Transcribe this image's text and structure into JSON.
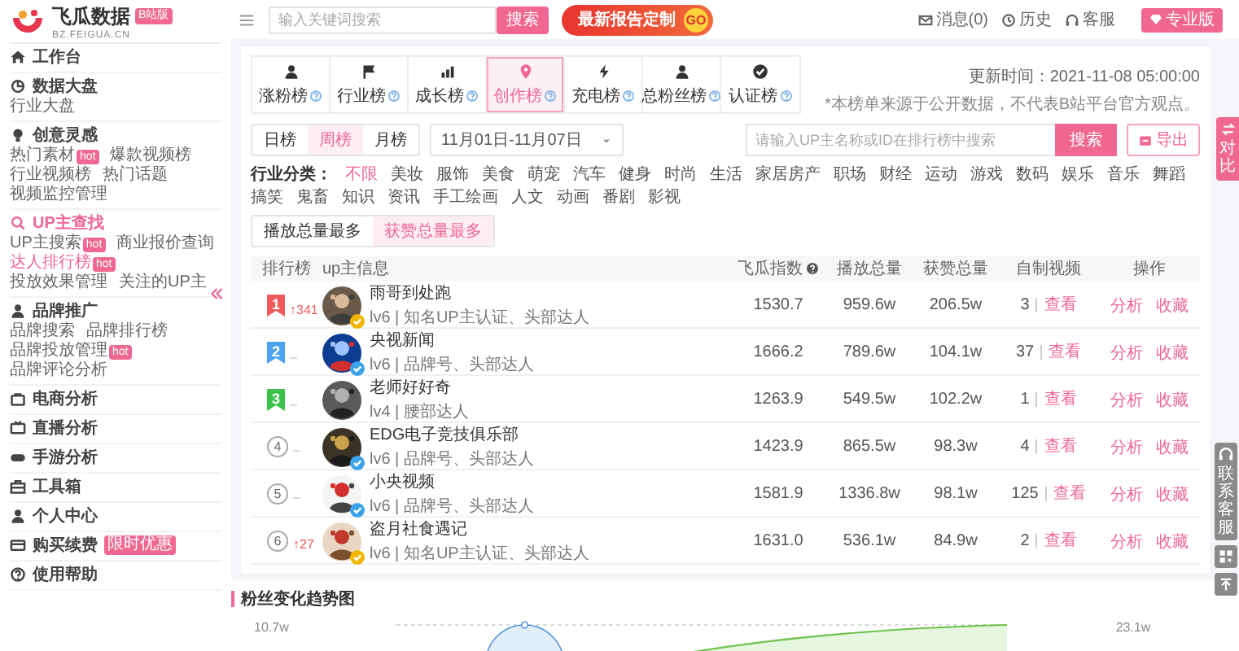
{
  "sidebar": {
    "logo": {
      "name": "飞瓜数据",
      "badge": "B站版",
      "domain": "BZ.FEIGUA.CN"
    },
    "sections": [
      {
        "kind": "home",
        "title": "工作台",
        "selected": false
      },
      {
        "kind": "chart",
        "title": "数据大盘",
        "selected": false,
        "items": [
          {
            "label": "行业大盘",
            "selected": false
          }
        ]
      },
      {
        "kind": "bulb",
        "title": "创意灵感",
        "selected": false,
        "items": [
          {
            "label": "热门素材",
            "badge": "hot",
            "selected": false
          },
          {
            "label": "爆款视频榜",
            "selected": false
          },
          {
            "label": "行业视频榜",
            "selected": false
          },
          {
            "label": "热门话题",
            "selected": false
          },
          {
            "label": "视频监控管理",
            "selected": false
          }
        ]
      },
      {
        "kind": "search",
        "title": "UP主查找",
        "selected": true,
        "items": [
          {
            "label": "UP主搜索",
            "badge": "hot",
            "selected": false
          },
          {
            "label": "商业报价查询",
            "selected": false
          },
          {
            "label": "达人排行榜",
            "badge": "hot",
            "selected": true
          },
          {
            "label": "投放效果管理",
            "selected": false
          },
          {
            "label": "关注的UP主",
            "selected": false
          }
        ]
      },
      {
        "kind": "user",
        "title": "品牌推广",
        "selected": false,
        "items": [
          {
            "label": "品牌搜索",
            "selected": false
          },
          {
            "label": "品牌排行榜",
            "selected": false
          },
          {
            "label": "品牌投放管理",
            "badge": "hot",
            "selected": false
          },
          {
            "label": "品牌评论分析",
            "selected": false
          }
        ]
      },
      {
        "kind": "cart",
        "title": "电商分析",
        "selected": false
      },
      {
        "kind": "live",
        "title": "直播分析",
        "selected": false
      },
      {
        "kind": "game",
        "title": "手游分析",
        "selected": false
      },
      {
        "kind": "tool",
        "title": "工具箱",
        "selected": false
      },
      {
        "kind": "user",
        "title": "个人中心",
        "selected": false
      },
      {
        "kind": "card",
        "title": "购买续费",
        "selected": false,
        "badge": "限时优惠"
      },
      {
        "kind": "help",
        "title": "使用帮助",
        "selected": false
      }
    ]
  },
  "topbar": {
    "search": {
      "placeholder": "输入关键词搜索"
    },
    "search_button": "搜索",
    "banner": {
      "title": "最新报告定制",
      "go": "GO"
    },
    "links": [
      {
        "kind": "mail",
        "label": "消息(0)"
      },
      {
        "kind": "clock",
        "label": "历史"
      },
      {
        "kind": "headset",
        "label": "客服"
      }
    ],
    "pro_button": "专业版"
  },
  "rank_tabs": [
    {
      "kind": "user",
      "label": "涨粉榜",
      "selected": false
    },
    {
      "kind": "flag",
      "label": "行业榜",
      "selected": false
    },
    {
      "kind": "growth",
      "label": "成长榜",
      "selected": false
    },
    {
      "kind": "pin",
      "label": "创作榜",
      "selected": true
    },
    {
      "kind": "bolt",
      "label": "充电榜",
      "selected": false
    },
    {
      "kind": "user",
      "label": "总粉丝榜",
      "selected": false
    },
    {
      "kind": "check",
      "label": "认证榜",
      "selected": false
    }
  ],
  "update": {
    "time": "更新时间：2021-11-08 05:00:00",
    "note": "*本榜单来源于公开数据，不代表B站平台官方观点。"
  },
  "periods": [
    {
      "label": "日榜",
      "selected": false
    },
    {
      "label": "周榜",
      "selected": true
    },
    {
      "label": "月榜",
      "selected": false
    }
  ],
  "date_range": "11月01日-11月07日",
  "rank_search": {
    "placeholder": "请输入UP主名称或ID在排行榜中搜索",
    "button": "搜索"
  },
  "export_button": "导出",
  "compare_tab": "对比",
  "categories": {
    "label": "行业分类：",
    "items": [
      {
        "label": "不限",
        "selected": true
      },
      {
        "label": "美妆",
        "selected": false
      },
      {
        "label": "服饰",
        "selected": false
      },
      {
        "label": "美食",
        "selected": false
      },
      {
        "label": "萌宠",
        "selected": false
      },
      {
        "label": "汽车",
        "selected": false
      },
      {
        "label": "健身",
        "selected": false
      },
      {
        "label": "时尚",
        "selected": false
      },
      {
        "label": "生活",
        "selected": false
      },
      {
        "label": "家居房产",
        "selected": false
      },
      {
        "label": "职场",
        "selected": false
      },
      {
        "label": "财经",
        "selected": false
      },
      {
        "label": "运动",
        "selected": false
      },
      {
        "label": "游戏",
        "selected": false
      },
      {
        "label": "数码",
        "selected": false
      },
      {
        "label": "娱乐",
        "selected": false
      },
      {
        "label": "音乐",
        "selected": false
      },
      {
        "label": "舞蹈",
        "selected": false
      },
      {
        "label": "搞笑",
        "selected": false
      },
      {
        "label": "鬼畜",
        "selected": false
      },
      {
        "label": "知识",
        "selected": false
      },
      {
        "label": "资讯",
        "selected": false
      },
      {
        "label": "手工绘画",
        "selected": false
      },
      {
        "label": "人文",
        "selected": false
      },
      {
        "label": "动画",
        "selected": false
      },
      {
        "label": "番剧",
        "selected": false
      },
      {
        "label": "影视",
        "selected": false
      }
    ]
  },
  "sorts": [
    {
      "label": "播放总量最多",
      "selected": false
    },
    {
      "label": "获赞总量最多",
      "selected": true
    }
  ],
  "table": {
    "columns": [
      {
        "label": "排行榜",
        "kind": "plain"
      },
      {
        "label": "up主信息",
        "kind": "plain"
      },
      {
        "label": "飞瓜指数",
        "kind": "help"
      },
      {
        "label": "播放总量",
        "kind": "plain"
      },
      {
        "label": "获赞总量",
        "kind": "plain"
      },
      {
        "label": "自制视频",
        "kind": "plain"
      },
      {
        "label": "操作",
        "kind": "plain"
      }
    ],
    "rows": [
      {
        "rank": {
          "number": "1",
          "kind": "ribbon",
          "color": "#ef5b5b"
        },
        "change": {
          "text": "↑341",
          "kind": "up"
        },
        "name": "雨哥到处跑",
        "desc": "lv6 | 知名UP主认证、头部达人",
        "badge": {
          "color": "#f2b600"
        },
        "index": "1530.7",
        "plays": "959.6w",
        "likes": "206.5w",
        "videos": "3",
        "view": "查看",
        "actions": [
          "分析",
          "收藏"
        ]
      },
      {
        "rank": {
          "number": "2",
          "kind": "ribbon",
          "color": "#4da3ef"
        },
        "change": {
          "text": "–",
          "kind": "flat"
        },
        "name": "央视新闻",
        "desc": "lv6 | 品牌号、头部达人",
        "badge": {
          "color": "#3ba4e8"
        },
        "index": "1666.2",
        "plays": "789.6w",
        "likes": "104.1w",
        "videos": "37",
        "view": "查看",
        "actions": [
          "分析",
          "收藏"
        ]
      },
      {
        "rank": {
          "number": "3",
          "kind": "ribbon",
          "color": "#3cc24a"
        },
        "change": {
          "text": "–",
          "kind": "flat"
        },
        "name": "老师好好奇",
        "desc": "lv4 | 腰部达人",
        "index": "1263.9",
        "plays": "549.5w",
        "likes": "102.2w",
        "videos": "1",
        "view": "查看",
        "actions": [
          "分析",
          "收藏"
        ]
      },
      {
        "rank": {
          "number": "4",
          "kind": "circle"
        },
        "change": {
          "text": "–",
          "kind": "flat"
        },
        "name": "EDG电子竞技俱乐部",
        "desc": "lv6 | 品牌号、头部达人",
        "badge": {
          "color": "#3ba4e8"
        },
        "index": "1423.9",
        "plays": "865.5w",
        "likes": "98.3w",
        "videos": "4",
        "view": "查看",
        "actions": [
          "分析",
          "收藏"
        ]
      },
      {
        "rank": {
          "number": "5",
          "kind": "circle"
        },
        "change": {
          "text": "–",
          "kind": "flat"
        },
        "name": "小央视频",
        "desc": "lv6 | 品牌号、头部达人",
        "badge": {
          "color": "#3ba4e8"
        },
        "index": "1581.9",
        "plays": "1336.8w",
        "likes": "98.1w",
        "videos": "125",
        "view": "查看",
        "actions": [
          "分析",
          "收藏"
        ]
      },
      {
        "rank": {
          "number": "6",
          "kind": "circle"
        },
        "change": {
          "text": "↑27",
          "kind": "up"
        },
        "name": "盗月社食遇记",
        "desc": "lv6 | 知名UP主认证、头部达人",
        "badge": {
          "color": "#f2b600"
        },
        "index": "1631.0",
        "plays": "536.1w",
        "likes": "84.9w",
        "videos": "2",
        "view": "查看",
        "actions": [
          "分析",
          "收藏"
        ]
      }
    ]
  },
  "float_tools": {
    "service": "联系客服"
  },
  "trend": {
    "title": "粉丝变化趋势图",
    "left_label": "10.7w",
    "right_label": "23.1w"
  }
}
